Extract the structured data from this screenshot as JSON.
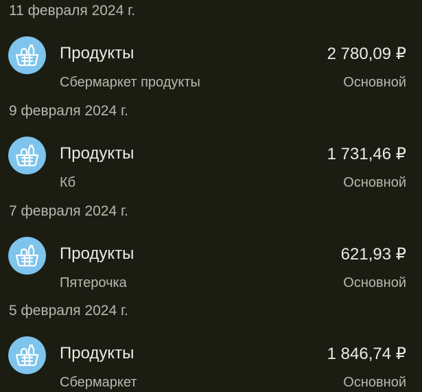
{
  "transactions": [
    {
      "date": "11 февраля 2024 г.",
      "category": "Продукты",
      "description": "Сбермаркет продукты",
      "amount": "2 780,09 ₽",
      "account": "Основной",
      "icon": "grocery-basket-icon"
    },
    {
      "date": "9 февраля 2024 г.",
      "category": "Продукты",
      "description": "Кб",
      "amount": "1 731,46 ₽",
      "account": "Основной",
      "icon": "grocery-basket-icon"
    },
    {
      "date": "7 февраля 2024 г.",
      "category": "Продукты",
      "description": "Пятерочка",
      "amount": "621,93 ₽",
      "account": "Основной",
      "icon": "grocery-basket-icon"
    },
    {
      "date": "5 февраля 2024 г.",
      "category": "Продукты",
      "description": "Сбермаркет",
      "amount": "1 846,74 ₽",
      "account": "Основной",
      "icon": "grocery-basket-icon"
    }
  ],
  "colors": {
    "background": "#1b1d13",
    "icon_background": "#7ec4ec",
    "primary_text": "#ecebe2",
    "secondary_text": "#b9b8ae"
  }
}
